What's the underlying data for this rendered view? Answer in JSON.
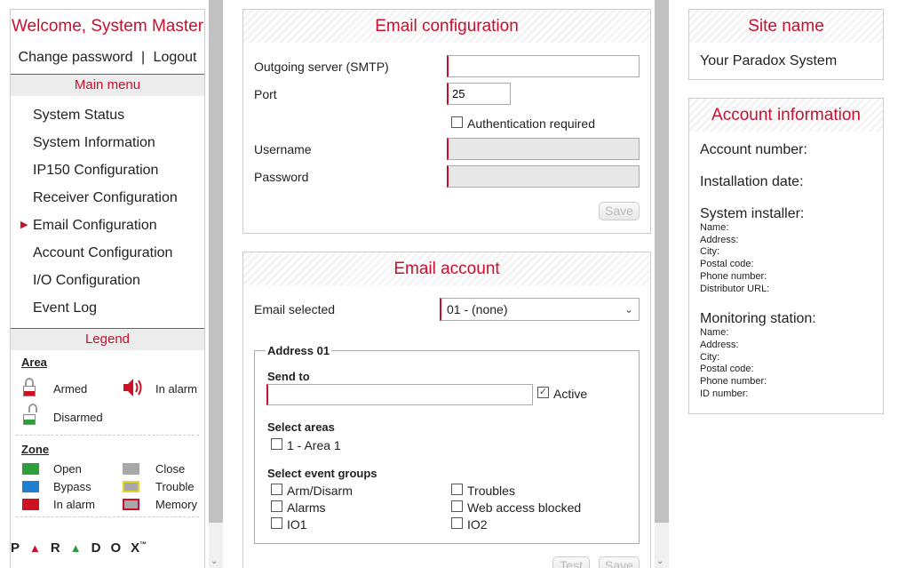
{
  "user": {
    "welcome": "Welcome, System Master",
    "change_password": "Change password",
    "separator": "|",
    "logout": "Logout"
  },
  "main_menu": {
    "title": "Main menu",
    "items": [
      {
        "label": "System Status"
      },
      {
        "label": "System Information"
      },
      {
        "label": "IP150 Configuration"
      },
      {
        "label": "Receiver Configuration"
      },
      {
        "label": "Email Configuration",
        "active": true
      },
      {
        "label": "Account Configuration"
      },
      {
        "label": "I/O Configuration"
      },
      {
        "label": "Event Log"
      }
    ]
  },
  "legend": {
    "title": "Legend",
    "area": {
      "title": "Area",
      "armed": "Armed",
      "in_alarm": "In alarm",
      "disarmed": "Disarmed"
    },
    "zone": {
      "title": "Zone",
      "items": [
        {
          "label": "Open",
          "color": "#2e9e3a"
        },
        {
          "label": "Close",
          "color": "#a8a8a8"
        },
        {
          "label": "Bypass",
          "color": "#1f7fd1"
        },
        {
          "label": "Trouble",
          "color": "#e8d22a"
        },
        {
          "label": "In alarm",
          "color": "#cc1122"
        },
        {
          "label": "Memory",
          "color": "#c8102e"
        }
      ]
    }
  },
  "brand": {
    "letters": [
      "P",
      "R",
      "D",
      "O",
      "X"
    ],
    "tm": "™"
  },
  "email_config": {
    "title": "Email configuration",
    "smtp_label": "Outgoing server (SMTP)",
    "smtp_value": "",
    "port_label": "Port",
    "port_value": "25",
    "auth_label": "Authentication required",
    "username_label": "Username",
    "password_label": "Password",
    "save": "Save"
  },
  "email_account": {
    "title": "Email account",
    "selected_label": "Email selected",
    "selected_value": "01 - (none)",
    "address_legend": "Address 01",
    "send_to": "Send to",
    "active": "Active",
    "select_areas": "Select areas",
    "area1": "1 - Area 1",
    "select_event_groups": "Select event groups",
    "groups": [
      "Arm/Disarm",
      "Troubles",
      "Alarms",
      "Web access blocked",
      "IO1",
      "IO2"
    ],
    "test": "Test",
    "save": "Save"
  },
  "site": {
    "title": "Site name",
    "name": "Your Paradox System"
  },
  "account_info": {
    "title": "Account information",
    "account_number": "Account number:",
    "installation_date": "Installation date:",
    "system_installer": "System installer:",
    "installer_fields": [
      "Name:",
      "Address:",
      "City:",
      "Postal code:",
      "Phone number:",
      "Distributor URL:"
    ],
    "monitoring_station": "Monitoring station:",
    "station_fields": [
      "Name:",
      "Address:",
      "City:",
      "Postal code:",
      "Phone number:",
      "ID number:"
    ]
  }
}
